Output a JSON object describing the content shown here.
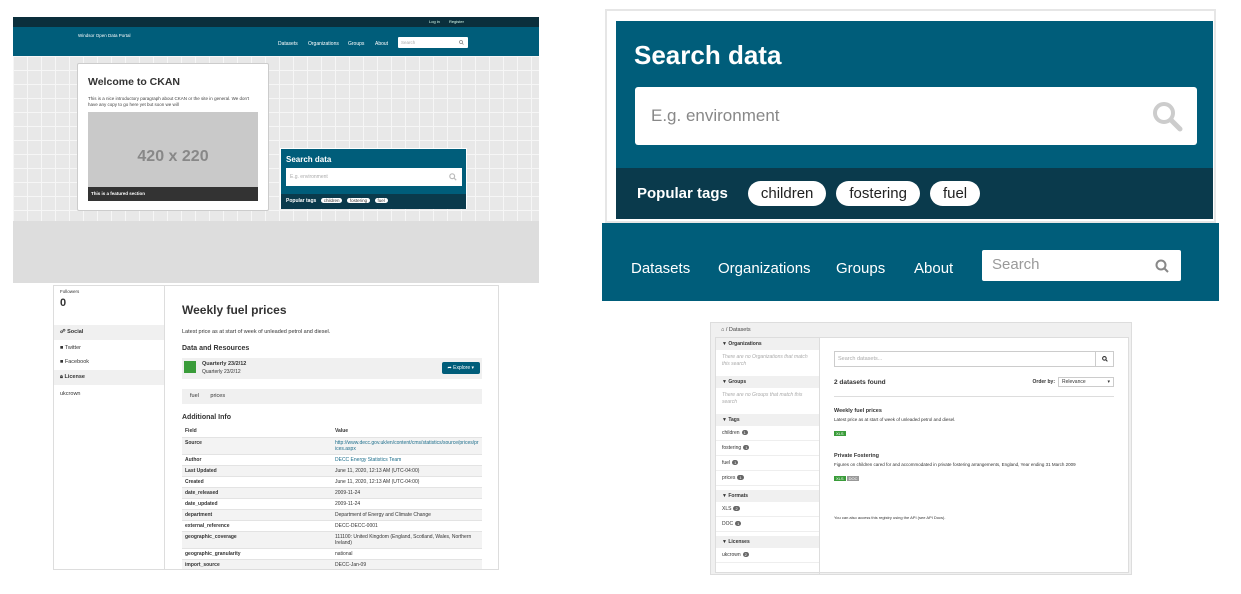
{
  "panel_a": {
    "account_links": [
      "Log in",
      "Register"
    ],
    "site_name": "Windsor Open Data Portal",
    "nav": [
      "Datasets",
      "Organizations",
      "Groups",
      "About"
    ],
    "search_placeholder": "Search",
    "welcome_title": "Welcome to CKAN",
    "welcome_text": "This is a nice introductory paragraph about CKAN or the site in general. We don't have any copy to go here yet but soon we will",
    "placeholder_image": "420 x 220",
    "featured_caption": "This is a featured section",
    "search_title": "Search data",
    "search_input_placeholder": "E.g. environment",
    "popular_tags_label": "Popular tags",
    "tags": [
      "children",
      "fostering",
      "fuel"
    ]
  },
  "panel_b": {
    "title": "Search data",
    "input_placeholder": "E.g. environment",
    "popular_tags_label": "Popular tags",
    "tags": [
      "children",
      "fostering",
      "fuel"
    ],
    "nav": [
      "Datasets",
      "Organizations",
      "Groups",
      "About"
    ],
    "nav_search_placeholder": "Search"
  },
  "panel_c": {
    "followers_label": "Followers",
    "followers_count": "0",
    "social_header": "Social",
    "social_links": [
      "Twitter",
      "Facebook"
    ],
    "license_header": "License",
    "license_value": "ukcrown",
    "title": "Weekly fuel prices",
    "description": "Latest price as at start of week of unleaded petrol and diesel.",
    "resources_header": "Data and Resources",
    "resource_title": "Quarterly 23/2/12",
    "resource_subtitle": "Quarterly 23/2/12",
    "explore_label": "Explore",
    "tags": [
      "fuel",
      "prices"
    ],
    "additional_info_header": "Additional Info",
    "table_header": [
      "Field",
      "Value"
    ],
    "rows": [
      [
        "Source",
        "http://www.decc.gov.uk/en/content/cms/statistics/source/prices/prices.aspx"
      ],
      [
        "Author",
        "DECC Energy Statistics Team"
      ],
      [
        "Last Updated",
        "June 11, 2020, 12:13 AM (UTC-04:00)"
      ],
      [
        "Created",
        "June 11, 2020, 12:13 AM (UTC-04:00)"
      ],
      [
        "date_released",
        "2009-11-24"
      ],
      [
        "date_updated",
        "2009-11-24"
      ],
      [
        "department",
        "Department of Energy and Climate Change"
      ],
      [
        "external_reference",
        "DECC-DECC-0001"
      ],
      [
        "geographic_coverage",
        "111100: United Kingdom (England, Scotland, Wales, Northern Ireland)"
      ],
      [
        "geographic_granularity",
        "national"
      ],
      [
        "import_source",
        "DECC-Jan-09"
      ]
    ]
  },
  "panel_d": {
    "breadcrumb": "Datasets",
    "facets": [
      {
        "title": "Organizations",
        "empty": "There are no Organizations that match this search"
      },
      {
        "title": "Groups",
        "empty": "There are no Groups that match this search"
      }
    ],
    "tags_title": "Tags",
    "tags": [
      {
        "name": "children",
        "count": "1"
      },
      {
        "name": "fostering",
        "count": "1"
      },
      {
        "name": "fuel",
        "count": "1"
      },
      {
        "name": "prices",
        "count": "1"
      }
    ],
    "formats_title": "Formats",
    "formats": [
      {
        "name": "XLS",
        "count": "2"
      },
      {
        "name": "DOC",
        "count": "1"
      }
    ],
    "licenses_title": "Licenses",
    "licenses": [
      {
        "name": "ukcrown",
        "count": "2"
      }
    ],
    "search_placeholder": "Search datasets...",
    "found": "2 datasets found",
    "order_label": "Order by:",
    "order_value": "Relevance",
    "datasets": [
      {
        "title": "Weekly fuel prices",
        "desc": "Latest price as at start of week of unleaded petrol and diesel.",
        "formats": [
          "XLS"
        ]
      },
      {
        "title": "Private Fostering",
        "desc": "Figures on children cared for and accommodated in private fostering arrangements, England, Year ending 31 March 2009",
        "formats": [
          "XLS",
          "DOC"
        ]
      }
    ],
    "api_text": "You can also access this registry using the API (see API Docs)."
  }
}
